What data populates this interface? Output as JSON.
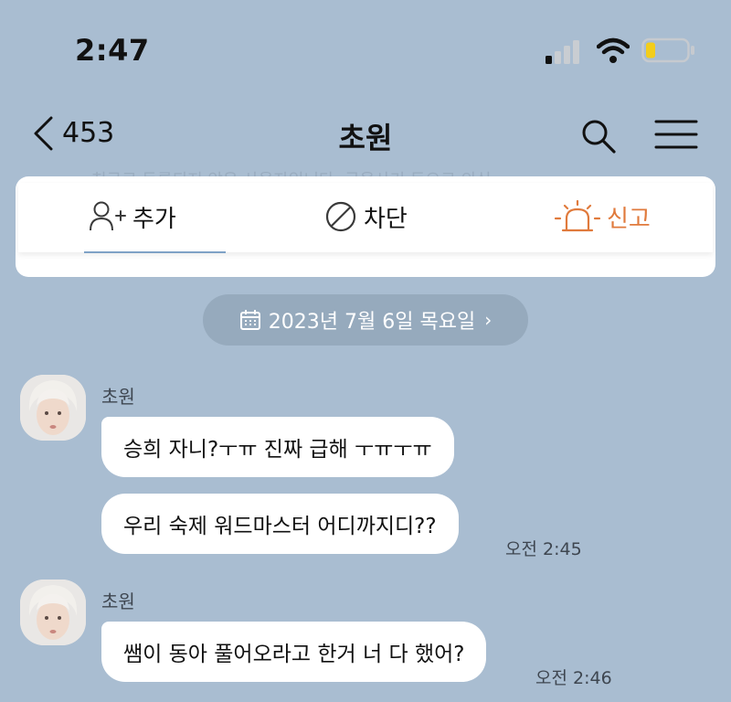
{
  "status": {
    "time": "2:47"
  },
  "header": {
    "back_count": "453",
    "title": "초원"
  },
  "banner": {
    "ghost_text": "친구로 등록되지 않은 사용자입니다. 금융사기 등으로 의심",
    "actions": {
      "add": "추가",
      "block": "차단",
      "report": "신고"
    }
  },
  "date_divider": {
    "label": "2023년 7월 6일 목요일",
    "chevron": "›"
  },
  "messages": [
    {
      "sender": "초원",
      "bubbles": [
        "승희 자니?ㅜㅠ 진짜 급해 ㅜㅠㅜㅠ",
        "우리 숙제 워드마스터 어디까지디??"
      ],
      "time": "오전 2:45"
    },
    {
      "sender": "초원",
      "bubbles": [
        "쌤이 동아 풀어오라고 한거 너 다 했어?"
      ],
      "time": "오전 2:46"
    }
  ],
  "colors": {
    "background": "#a9bdd1",
    "report": "#e07a3c",
    "battery": "#f3cd1b"
  }
}
